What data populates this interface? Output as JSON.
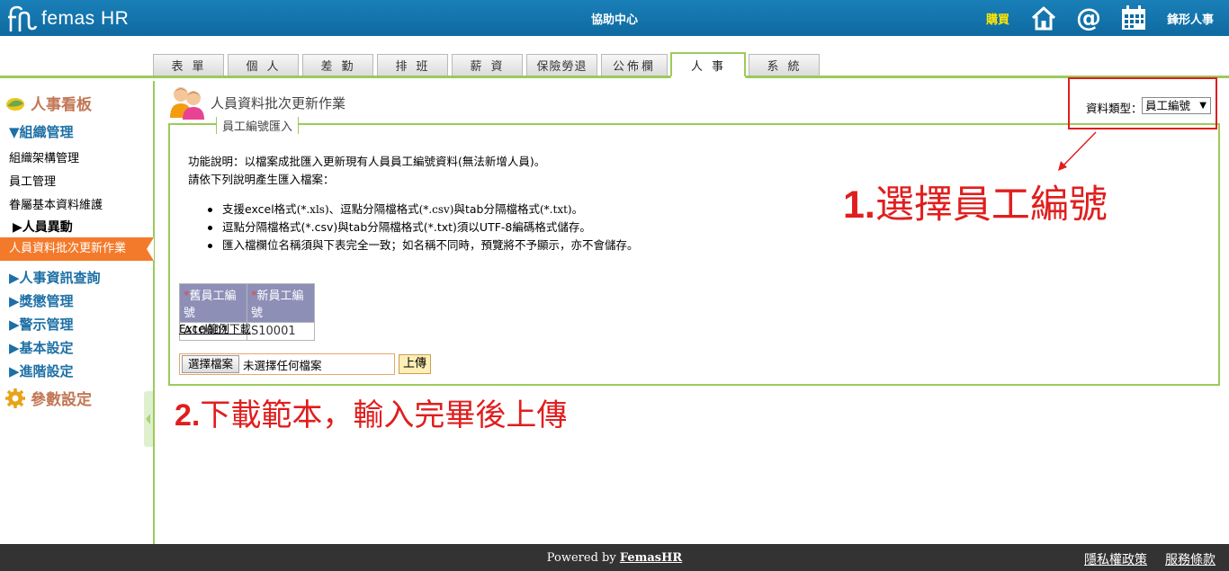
{
  "header": {
    "logo_text": "femas HR",
    "help_center": "協助中心",
    "buy": "購買",
    "company": "鋒形人事",
    "icons": [
      "home-icon",
      "at-icon",
      "calendar-icon"
    ]
  },
  "tabs": [
    {
      "label": "表單"
    },
    {
      "label": "個人"
    },
    {
      "label": "差勤"
    },
    {
      "label": "排班"
    },
    {
      "label": "薪資"
    },
    {
      "label": "保險勞退"
    },
    {
      "label": "公佈欄"
    },
    {
      "label": "人事",
      "active": true
    },
    {
      "label": "系統"
    }
  ],
  "sidebar": {
    "dashboard": "人事看板",
    "org_group": "▼組織管理",
    "org_items": [
      "組織架構管理",
      "員工管理",
      "眷屬基本資料維護"
    ],
    "personnel_change": "▶人員異動",
    "active_item": "人員資料批次更新作業",
    "groups": [
      "▶人事資訊查詢",
      "▶獎懲管理",
      "▶警示管理",
      "▶基本設定",
      "▶進階設定"
    ],
    "params": "參數設定"
  },
  "main": {
    "page_title": "人員資料批次更新作業",
    "legend": "員工編號匯入",
    "desc_line1": "功能說明：以檔案成批匯入更新現有人員員工編號資料(無法新增人員)。",
    "desc_line2": "請依下列說明產生匯入檔案：",
    "bullet1_a": "支援excel格式",
    "bullet1_b": "(*.xls)",
    "bullet1_c": "、逗點分隔檔格式",
    "bullet1_d": "(*.csv)",
    "bullet1_e": "與tab分隔檔格式",
    "bullet1_f": "(*.txt)",
    "bullet1_g": "。",
    "bullet2": "逗點分隔檔格式(*.csv)與tab分隔檔格式(*.txt)須以UTF-8編碼格式儲存。",
    "bullet3": "匯入檔欄位名稱須與下表完全一致；如名稱不同時，預覽將不予顯示，亦不會儲存。",
    "table": {
      "required_mark": "*",
      "headers": [
        "舊員工編號",
        "新員工編號"
      ],
      "row": [
        "A10001",
        "S10001"
      ]
    },
    "excel_link": "Excel範例下載",
    "file_button": "選擇檔案",
    "file_status": "未選擇任何檔案",
    "upload": "上傳",
    "type_label": "資料類型：",
    "type_value": "員工編號",
    "callout1_num": "1.",
    "callout1_text": "選擇員工編號",
    "callout2_num": "2.",
    "callout2_text": "下載範本，輸入完畢後上傳",
    "accent_color": "#9bcb5a",
    "callout_color": "#e01e1e"
  },
  "footer": {
    "powered_prefix": "Powered by ",
    "powered_link": "FemasHR",
    "privacy": "隱私權政策",
    "terms": "服務條款"
  }
}
